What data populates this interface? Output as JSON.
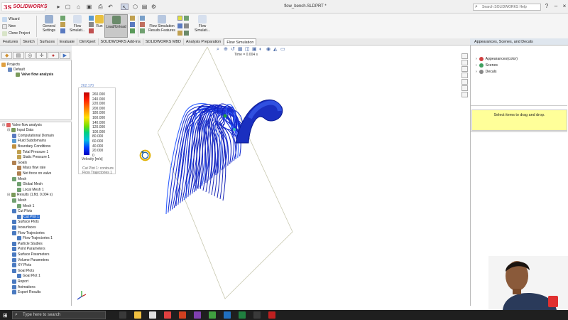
{
  "window": {
    "app_name": "SOLIDWORKS",
    "document_title": "flow_bench.SLDPRT *",
    "search_placeholder": "Search SOLIDWORKS Help"
  },
  "ribbon": {
    "wizard": "Wizard",
    "new": "New",
    "clone_project": "Clone Project",
    "general_settings": "General Settings",
    "flow_simulation": "Flow Simulati...",
    "run": "Run",
    "load_unload": "Load/Unload",
    "flow_simulation_results_features": "Flow Simulation Results Features",
    "flow_simulation_2": "Flow Simulati..."
  },
  "tabs": [
    "Features",
    "Sketch",
    "Surfaces",
    "Evaluate",
    "DimXpert",
    "SOLIDWORKS Add-Ins",
    "SOLIDWORKS MBD",
    "Analysis Preparation",
    "Flow Simulation"
  ],
  "active_tab": "Flow Simulation",
  "projects_tree": {
    "root": "Projects",
    "default": "Default",
    "valve": "Valve flow analysis"
  },
  "analysis_tree": [
    {
      "label": "Valve flow analysis",
      "level": 0,
      "color": "#e06060"
    },
    {
      "label": "Input Data",
      "level": 1,
      "color": "#7a9a5a"
    },
    {
      "label": "Computational Domain",
      "level": 2,
      "color": "#5a7ac0"
    },
    {
      "label": "Fluid Subdomains",
      "level": 2,
      "color": "#5a9ad0"
    },
    {
      "label": "Boundary Conditions",
      "level": 2,
      "color": "#c09040"
    },
    {
      "label": "Total Pressure 1",
      "level": 3,
      "color": "#c0a050"
    },
    {
      "label": "Static Pressure 1",
      "level": 3,
      "color": "#c0a050"
    },
    {
      "label": "Goals",
      "level": 2,
      "color": "#b08050"
    },
    {
      "label": "Mass flow rate",
      "level": 3,
      "color": "#b08050"
    },
    {
      "label": "Net force on valve",
      "level": 3,
      "color": "#b08050"
    },
    {
      "label": "Mesh",
      "level": 2,
      "color": "#70a070"
    },
    {
      "label": "Global Mesh",
      "level": 3,
      "color": "#70a070"
    },
    {
      "label": "Local Mesh 1",
      "level": 3,
      "color": "#70a070"
    },
    {
      "label": "Results (1.fld, 0.004 s)",
      "level": 1,
      "color": "#7a9a5a"
    },
    {
      "label": "Mesh",
      "level": 2,
      "color": "#70a070"
    },
    {
      "label": "Mesh 1",
      "level": 3,
      "color": "#70a070"
    },
    {
      "label": "Cut Plots",
      "level": 2,
      "color": "#4a7ac0"
    },
    {
      "label": "Cut Plot 1",
      "level": 3,
      "color": "#4a7ac0",
      "selected": true
    },
    {
      "label": "Surface Plots",
      "level": 2,
      "color": "#4a7ac0"
    },
    {
      "label": "Isosurfaces",
      "level": 2,
      "color": "#4a7ac0"
    },
    {
      "label": "Flow Trajectories",
      "level": 2,
      "color": "#4a7ac0"
    },
    {
      "label": "Flow Trajectories 1",
      "level": 3,
      "color": "#4a7ac0"
    },
    {
      "label": "Particle Studies",
      "level": 2,
      "color": "#4a7ac0"
    },
    {
      "label": "Point Parameters",
      "level": 2,
      "color": "#4a7ac0"
    },
    {
      "label": "Surface Parameters",
      "level": 2,
      "color": "#4a7ac0"
    },
    {
      "label": "Volume Parameters",
      "level": 2,
      "color": "#4a7ac0"
    },
    {
      "label": "XY Plots",
      "level": 2,
      "color": "#4a7ac0"
    },
    {
      "label": "Goal Plots",
      "level": 2,
      "color": "#4a7ac0"
    },
    {
      "label": "Goal Plot 1",
      "level": 3,
      "color": "#4a7ac0"
    },
    {
      "label": "Report",
      "level": 2,
      "color": "#4a7ac0"
    },
    {
      "label": "Animations",
      "level": 2,
      "color": "#4a7ac0"
    },
    {
      "label": "Export Results",
      "level": 2,
      "color": "#4a7ac0"
    }
  ],
  "legend": {
    "max_value": "262.170",
    "ticks": [
      "260.000",
      "240.000",
      "220.000",
      "200.000",
      "180.000",
      "160.000",
      "140.000",
      "120.000",
      "100.000",
      "80.000",
      "60.000",
      "40.000",
      "20.000",
      "0"
    ],
    "units": "Velocity [m/s]",
    "caption1": "Cut Plot 1: contours",
    "caption2": "Flow Trajectories 1"
  },
  "graphics": {
    "time_label": "Time = 0.004 s"
  },
  "right_panel": {
    "title": "Appearances, Scenes, and Decals",
    "items": [
      {
        "label": "Appearances(color)",
        "color": "#d04040"
      },
      {
        "label": "Scenes",
        "color": "#40a060"
      },
      {
        "label": "Decals",
        "color": "#888888"
      }
    ],
    "hint": "Select items to drag and drop."
  },
  "taskbar": {
    "search_placeholder": "Type here to search",
    "apps": [
      {
        "name": "task-view",
        "color": "#3a3a3a"
      },
      {
        "name": "file-explorer",
        "color": "#f0c040"
      },
      {
        "name": "store",
        "color": "#e0e0e0"
      },
      {
        "name": "chrome",
        "color": "#e04040"
      },
      {
        "name": "powerpoint",
        "color": "#d04020"
      },
      {
        "name": "onenote",
        "color": "#8040b0"
      },
      {
        "name": "camtasia",
        "color": "#40a040"
      },
      {
        "name": "vscode",
        "color": "#2070c0"
      },
      {
        "name": "excel",
        "color": "#208040"
      },
      {
        "name": "camtasia-2",
        "color": "#3a3a3a"
      },
      {
        "name": "solidworks",
        "color": "#c02020"
      }
    ]
  }
}
